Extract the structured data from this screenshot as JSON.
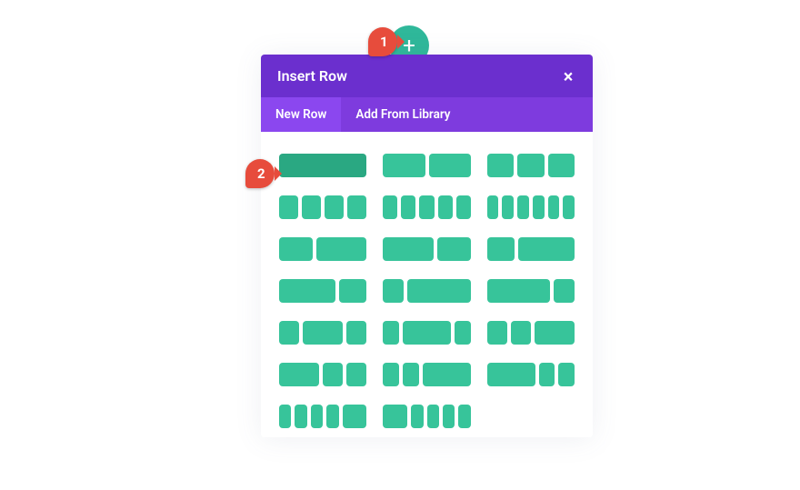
{
  "add_button": {
    "icon": "plus-icon",
    "glyph": "+"
  },
  "modal": {
    "title": "Insert Row",
    "close_glyph": "×",
    "tabs": {
      "new_row": "New Row",
      "library": "Add From Library",
      "active": "new_row"
    }
  },
  "markers": {
    "one": "1",
    "two": "2"
  },
  "layouts": [
    {
      "id": "1_1",
      "cols": [
        "1-1"
      ],
      "hovered": true
    },
    {
      "id": "1_2_1_2",
      "cols": [
        "1-2",
        "1-2"
      ]
    },
    {
      "id": "1_3_1_3_1_3",
      "cols": [
        "1-3",
        "1-3",
        "1-3"
      ]
    },
    {
      "id": "1_4_x4",
      "cols": [
        "1-4",
        "1-4",
        "1-4",
        "1-4"
      ]
    },
    {
      "id": "1_5_x5",
      "cols": [
        "1-5",
        "1-5",
        "1-5",
        "1-5",
        "1-5"
      ]
    },
    {
      "id": "1_6_x6",
      "cols": [
        "1-6",
        "1-6",
        "1-6",
        "1-6",
        "1-6",
        "1-6"
      ]
    },
    {
      "id": "2_5_3_5",
      "cols": [
        "2-5",
        "3-5"
      ]
    },
    {
      "id": "3_5_2_5",
      "cols": [
        "3-5",
        "2-5"
      ]
    },
    {
      "id": "1_3_2_3",
      "cols": [
        "1-3",
        "2-3"
      ]
    },
    {
      "id": "2_3_1_3",
      "cols": [
        "2-3",
        "1-3"
      ]
    },
    {
      "id": "1_4_3_4",
      "cols": [
        "1-4n",
        "3-4"
      ]
    },
    {
      "id": "3_4_1_4",
      "cols": [
        "3-4",
        "1-4n"
      ]
    },
    {
      "id": "1_4_1_2_1_4",
      "cols": [
        "1-4",
        "2-4",
        "1-4"
      ]
    },
    {
      "id": "1_5_3_5_1_5",
      "cols": [
        "1-5",
        "3-5",
        "1-5"
      ]
    },
    {
      "id": "1_4_1_4_1_2",
      "cols": [
        "1-4",
        "1-4",
        "2-4"
      ]
    },
    {
      "id": "1_2_1_4_1_4",
      "cols": [
        "2-4",
        "1-4",
        "1-4"
      ]
    },
    {
      "id": "1_5_1_5_3_5",
      "cols": [
        "1-5",
        "1-5",
        "3-5"
      ]
    },
    {
      "id": "3_5_1_5_1_5",
      "cols": [
        "3-5",
        "1-5",
        "1-5"
      ]
    },
    {
      "id": "1_6_1_6_4_6",
      "cols": [
        "1-6",
        "1-6",
        "1-6",
        "1-6",
        "2-4"
      ]
    },
    {
      "id": "4_6_1_6_1_6",
      "cols": [
        "2-4",
        "1-6",
        "1-6",
        "1-6",
        "1-6"
      ]
    }
  ]
}
